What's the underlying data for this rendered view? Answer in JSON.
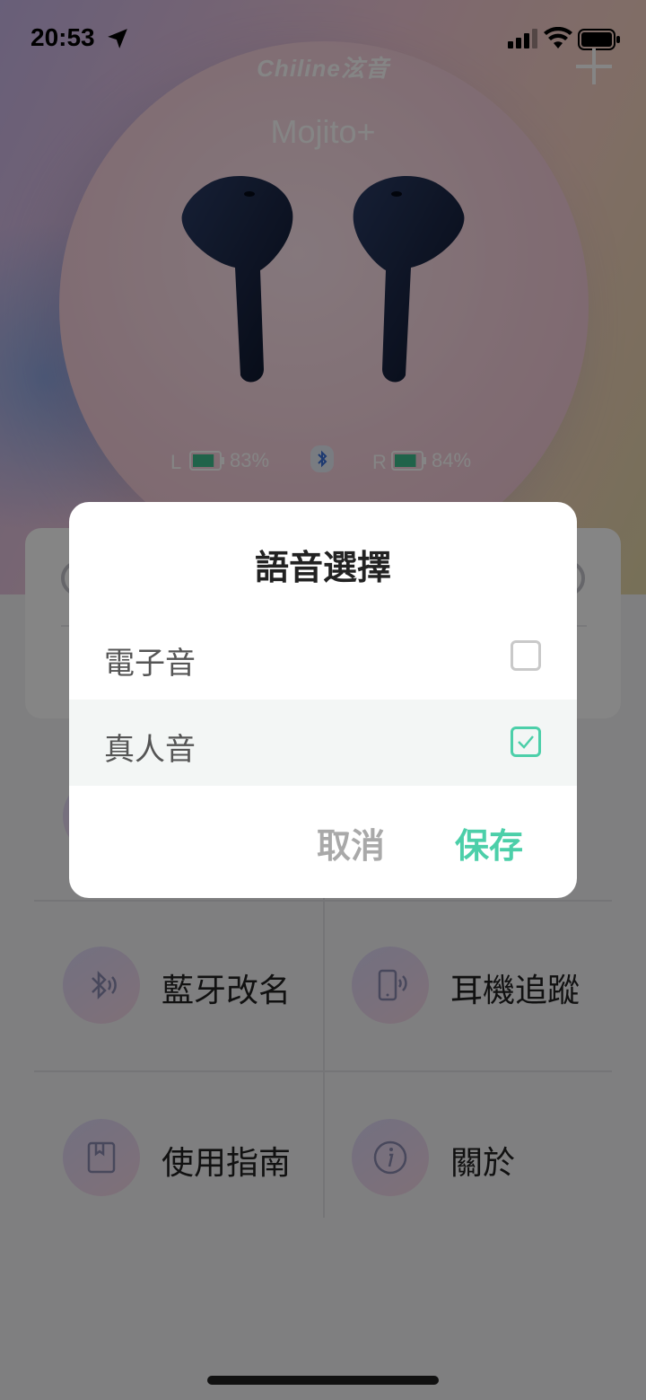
{
  "status_bar": {
    "time": "20:53"
  },
  "header": {
    "brand": "Chiline泫音",
    "device_name": "Mojito+"
  },
  "battery": {
    "left_label": "L",
    "left_percent": "83%",
    "left_level": 0.83,
    "right_label": "R",
    "right_percent": "84%",
    "right_level": 0.84
  },
  "features": [
    {
      "label": "藍牙改名",
      "icon": "bluetooth-icon"
    },
    {
      "label": "耳機追蹤",
      "icon": "phone-tracking-icon"
    },
    {
      "label": "使用指南",
      "icon": "book-icon"
    },
    {
      "label": "關於",
      "icon": "info-icon"
    }
  ],
  "dialog": {
    "title": "語音選擇",
    "options": [
      {
        "label": "電子音",
        "checked": false
      },
      {
        "label": "真人音",
        "checked": true
      }
    ],
    "cancel_label": "取消",
    "save_label": "保存"
  },
  "colors": {
    "accent": "#4ccfa9",
    "cancel_text": "#a9a9a9",
    "battery_fill": "#3fbf8f"
  }
}
